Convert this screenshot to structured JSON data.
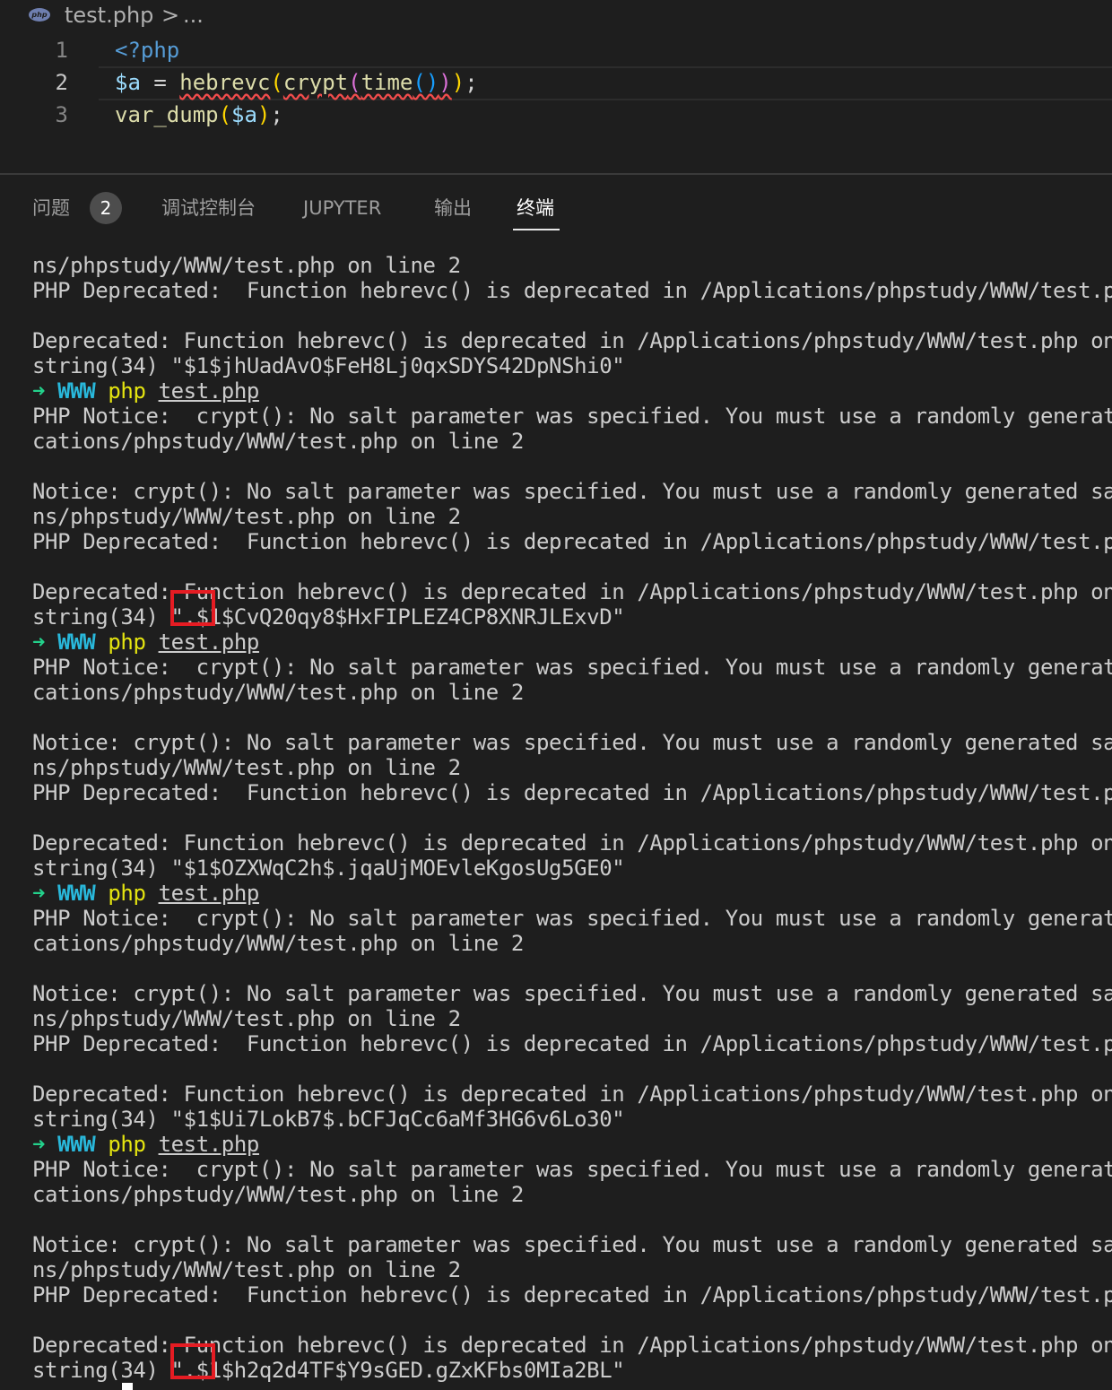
{
  "breadcrumb": {
    "icon": "php-file-icon",
    "icon_text": "php",
    "file": "test.php",
    "separator": ">",
    "more": "..."
  },
  "editor": {
    "lines": [
      {
        "number": "1",
        "text": "<?php"
      },
      {
        "number": "2",
        "text": "$a = hebrevc(crypt(time()));"
      },
      {
        "number": "3",
        "text": "var_dump($a);"
      }
    ],
    "active_line": 2
  },
  "panel": {
    "tabs": [
      {
        "label": "问题",
        "badge": "2"
      },
      {
        "label": "调试控制台"
      },
      {
        "label": "JUPYTER"
      },
      {
        "label": "输出"
      },
      {
        "label": "终端",
        "active": true
      }
    ]
  },
  "terminal": {
    "prompt": {
      "arrow": "➜",
      "dir": "WWW",
      "cmd": "php",
      "arg": "test.php"
    },
    "lines": [
      "ns/phpstudy/WWW/test.php on line 2",
      "PHP Deprecated:  Function hebrevc() is deprecated in /Applications/phpstudy/WWW/test.p",
      "",
      "Deprecated: Function hebrevc() is deprecated in /Applications/phpstudy/WWW/test.php on",
      "string(34) \"$1$jhUadAvO$FeH8Lj0qxSDYS42DpNShi0\"",
      "@prompt",
      "PHP Notice:  crypt(): No salt parameter was specified. You must use a randomly generat",
      "cations/phpstudy/WWW/test.php on line 2",
      "",
      "Notice: crypt(): No salt parameter was specified. You must use a randomly generated sa",
      "ns/phpstudy/WWW/test.php on line 2",
      "PHP Deprecated:  Function hebrevc() is deprecated in /Applications/phpstudy/WWW/test.p",
      "",
      "Deprecated: Function hebrevc() is deprecated in /Applications/phpstudy/WWW/test.php on",
      "string(34) \".$1$CvQ20qy8$HxFIPLEZ4CP8XNRJLExvD\"",
      "@prompt",
      "PHP Notice:  crypt(): No salt parameter was specified. You must use a randomly generat",
      "cations/phpstudy/WWW/test.php on line 2",
      "",
      "Notice: crypt(): No salt parameter was specified. You must use a randomly generated sa",
      "ns/phpstudy/WWW/test.php on line 2",
      "PHP Deprecated:  Function hebrevc() is deprecated in /Applications/phpstudy/WWW/test.p",
      "",
      "Deprecated: Function hebrevc() is deprecated in /Applications/phpstudy/WWW/test.php on",
      "string(34) \"$1$OZXWqC2h$.jqaUjMOEvleKgosUg5GE0\"",
      "@prompt",
      "PHP Notice:  crypt(): No salt parameter was specified. You must use a randomly generat",
      "cations/phpstudy/WWW/test.php on line 2",
      "",
      "Notice: crypt(): No salt parameter was specified. You must use a randomly generated sa",
      "ns/phpstudy/WWW/test.php on line 2",
      "PHP Deprecated:  Function hebrevc() is deprecated in /Applications/phpstudy/WWW/test.p",
      "",
      "Deprecated: Function hebrevc() is deprecated in /Applications/phpstudy/WWW/test.php on",
      "string(34) \"$1$Ui7LokB7$.bCFJqCc6aMf3HG6v6Lo30\"",
      "@prompt",
      "PHP Notice:  crypt(): No salt parameter was specified. You must use a randomly generat",
      "cations/phpstudy/WWW/test.php on line 2",
      "",
      "Notice: crypt(): No salt parameter was specified. You must use a randomly generated sa",
      "ns/phpstudy/WWW/test.php on line 2",
      "PHP Deprecated:  Function hebrevc() is deprecated in /Applications/phpstudy/WWW/test.p",
      "",
      "Deprecated: Function hebrevc() is deprecated in /Applications/phpstudy/WWW/test.php on",
      "string(34) \".$1$h2q2d4TF$Y9sGED.gZxKFbs0MIa2BL\""
    ],
    "highlighted_lines": [
      14,
      44
    ]
  },
  "colors": {
    "background": "#1e1e1e",
    "highlight_box": "#e51c23",
    "prompt_dot": "#3794ff"
  }
}
